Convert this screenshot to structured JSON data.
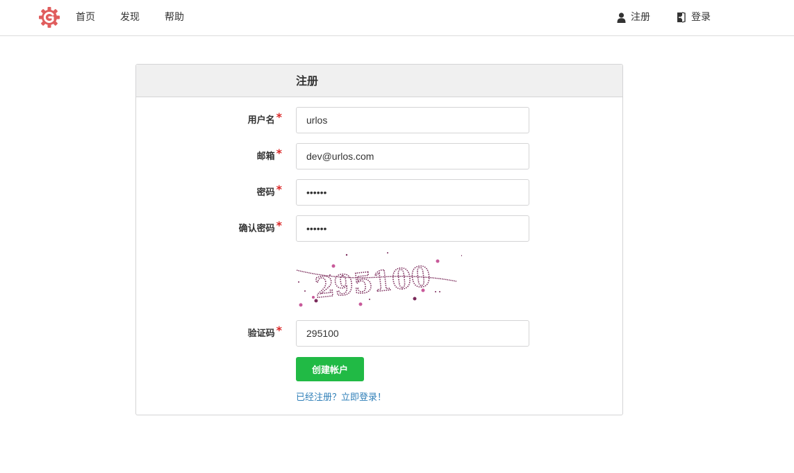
{
  "nav": {
    "home": "首页",
    "explore": "发现",
    "help": "帮助",
    "register": "注册",
    "login": "登录"
  },
  "form": {
    "title": "注册",
    "username_label": "用户名",
    "username_value": "urlos",
    "email_label": "邮箱",
    "email_value": "dev@urlos.com",
    "password_label": "密码",
    "password_value": "••••••",
    "confirm_label": "确认密码",
    "confirm_value": "••••••",
    "captcha_text": "295100",
    "captcha_label": "验证码",
    "captcha_value": "295100",
    "required_mark": "*",
    "submit_label": "创建帐户",
    "login_link": "已经注册？立即登录！"
  },
  "colors": {
    "logo": "#e05d5d",
    "submit": "#21ba45",
    "link": "#2f7fb8",
    "required": "#db2828",
    "captcha": "#7a2a5a"
  },
  "icons": {
    "logo": "gogs-gear-logo",
    "register": "user-icon",
    "login": "sign-in-icon"
  }
}
